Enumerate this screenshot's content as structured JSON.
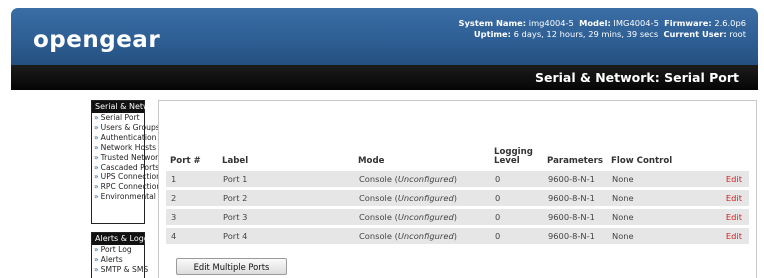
{
  "header": {
    "logo": "opengear",
    "system_name_label": "System Name:",
    "system_name": "img4004-5",
    "model_label": "Model:",
    "model": "IMG4004-5",
    "firmware_label": "Firmware:",
    "firmware": "2.6.0p6",
    "uptime_label": "Uptime:",
    "uptime": "6 days, 12 hours, 29 mins, 39 secs",
    "current_user_label": "Current User:",
    "current_user": "root",
    "page_title": "Serial & Network: Serial Port"
  },
  "sidebar": {
    "groups": [
      {
        "title": "Serial & Network",
        "items": [
          {
            "label": "Serial Port"
          },
          {
            "label": "Users & Groups"
          },
          {
            "label": "Authentication"
          },
          {
            "label": "Network Hosts"
          },
          {
            "label": "Trusted Networks"
          },
          {
            "label": "Cascaded Ports"
          },
          {
            "label": "UPS Connections"
          },
          {
            "label": "RPC Connections"
          },
          {
            "label": "Environmental"
          }
        ]
      },
      {
        "title": "Alerts & Logging",
        "items": [
          {
            "label": "Port Log"
          },
          {
            "label": "Alerts"
          },
          {
            "label": "SMTP & SMS"
          }
        ]
      }
    ],
    "bullet": "»"
  },
  "table": {
    "columns": [
      "Port #",
      "Label",
      "Mode",
      "Logging Level",
      "Parameters",
      "Flow Control",
      ""
    ],
    "rows": [
      {
        "port": "1",
        "label": "Port 1",
        "mode": "Console",
        "mode_status": "Unconfigured",
        "logging": "0",
        "params": "9600-8-N-1",
        "flow": "None",
        "action": "Edit"
      },
      {
        "port": "2",
        "label": "Port 2",
        "mode": "Console",
        "mode_status": "Unconfigured",
        "logging": "0",
        "params": "9600-8-N-1",
        "flow": "None",
        "action": "Edit"
      },
      {
        "port": "3",
        "label": "Port 3",
        "mode": "Console",
        "mode_status": "Unconfigured",
        "logging": "0",
        "params": "9600-8-N-1",
        "flow": "None",
        "action": "Edit"
      },
      {
        "port": "4",
        "label": "Port 4",
        "mode": "Console",
        "mode_status": "Unconfigured",
        "logging": "0",
        "params": "9600-8-N-1",
        "flow": "None",
        "action": "Edit"
      }
    ],
    "edit_multiple_label": "Edit Multiple Ports"
  },
  "colors": {
    "header_blue": "#2e5f95",
    "title_bar": "#0a0a0a",
    "edit_link": "#d42020",
    "row_bg": "#e6e6e6"
  }
}
